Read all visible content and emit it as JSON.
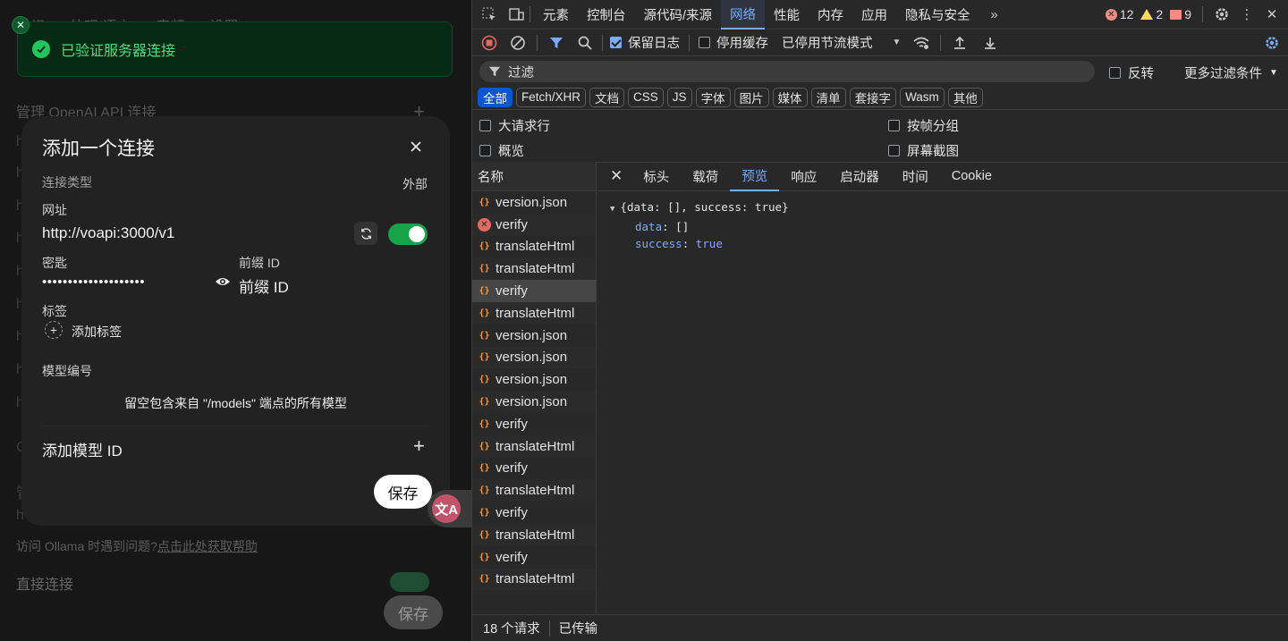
{
  "left_app": {
    "bg_tabs": [
      "常规",
      "外观/语言",
      "音频",
      "设置"
    ],
    "bg_section_title": "管理 OpenAI API 连接",
    "bg_footer_help": "访问 Ollama 时遇到问题?",
    "bg_footer_link": "点击此处获取帮助",
    "bg_direct": "直接连接",
    "bg_save": "保存",
    "toast": {
      "text": "已验证服务器连接"
    },
    "modal": {
      "title": "添加一个连接",
      "conn_type_label": "连接类型",
      "conn_type_value": "外部",
      "url_label": "网址",
      "url_value": "http://voapi:3000/v1",
      "key_label": "密匙",
      "key_value": "••••••••••••••••••••",
      "prefix_label": "前缀 ID",
      "prefix_placeholder": "前缀 ID",
      "tags_label": "标签",
      "add_tag": "添加标签",
      "model_ids_label": "模型编号",
      "model_hint": "留空包含来自 \"/models\" 端点的所有模型",
      "add_model_placeholder": "添加模型 ID",
      "save": "保存"
    }
  },
  "devtools": {
    "tabs": [
      "元素",
      "控制台",
      "源代码/来源",
      "网络",
      "性能",
      "内存",
      "应用",
      "隐私与安全"
    ],
    "errors": "12",
    "warnings": "2",
    "issues": "9",
    "preserve_log": "保留日志",
    "disable_cache": "停用缓存",
    "throttle": "已停用节流模式",
    "filter_placeholder": "过滤",
    "invert": "反转",
    "more_filters": "更多过滤条件",
    "chips": [
      "全部",
      "Fetch/XHR",
      "文档",
      "CSS",
      "JS",
      "字体",
      "图片",
      "媒体",
      "清单",
      "套接字",
      "Wasm",
      "其他"
    ],
    "opt_big_rows": "大请求行",
    "opt_group_frame": "按帧分组",
    "opt_overview": "概览",
    "opt_screenshots": "屏幕截图",
    "name_header": "名称",
    "requests": [
      {
        "name": "version.json",
        "type": "ok"
      },
      {
        "name": "verify",
        "type": "fail"
      },
      {
        "name": "translateHtml",
        "type": "ok"
      },
      {
        "name": "translateHtml",
        "type": "ok"
      },
      {
        "name": "verify",
        "type": "ok"
      },
      {
        "name": "translateHtml",
        "type": "ok"
      },
      {
        "name": "version.json",
        "type": "ok"
      },
      {
        "name": "version.json",
        "type": "ok"
      },
      {
        "name": "version.json",
        "type": "ok"
      },
      {
        "name": "version.json",
        "type": "ok"
      },
      {
        "name": "verify",
        "type": "ok"
      },
      {
        "name": "translateHtml",
        "type": "ok"
      },
      {
        "name": "verify",
        "type": "ok"
      },
      {
        "name": "translateHtml",
        "type": "ok"
      },
      {
        "name": "verify",
        "type": "ok"
      },
      {
        "name": "translateHtml",
        "type": "ok"
      },
      {
        "name": "verify",
        "type": "ok"
      },
      {
        "name": "translateHtml",
        "type": "ok"
      }
    ],
    "detail_tabs": [
      "标头",
      "载荷",
      "预览",
      "响应",
      "启动器",
      "时间",
      "Cookie"
    ],
    "preview": {
      "summary": "{data: [], success: true}",
      "data_key": "data",
      "data_val": "[]",
      "success_key": "success",
      "success_val": "true"
    },
    "status_count": "18 个请求",
    "status_transfer": "已传输"
  }
}
